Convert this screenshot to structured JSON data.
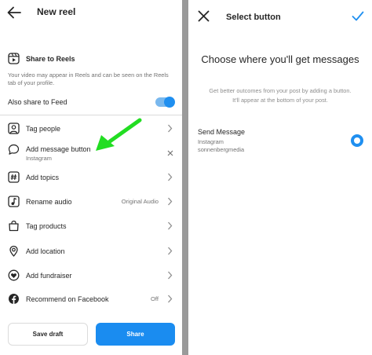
{
  "left": {
    "header": {
      "title": "New reel"
    },
    "share_to_reels": {
      "title": "Share to Reels",
      "description": "Your video may appear in Reels and can be seen on the Reels tab of your profile."
    },
    "also_share": {
      "label": "Also share to Feed",
      "enabled": true
    },
    "rows": [
      {
        "label": "Tag people",
        "icon": "person-icon"
      },
      {
        "label": "Add message button",
        "sublabel": "Instagram",
        "icon": "speech-bubble-icon"
      },
      {
        "label": "Add topics",
        "icon": "hashtag-icon"
      },
      {
        "label": "Rename audio",
        "value": "Original Audio",
        "icon": "music-note-icon"
      },
      {
        "label": "Tag products",
        "icon": "shopping-bag-icon"
      },
      {
        "label": "Add location",
        "icon": "location-pin-icon"
      },
      {
        "label": "Add fundraiser",
        "icon": "fundraiser-icon"
      },
      {
        "label": "Recommend on Facebook",
        "value": "Off",
        "icon": "facebook-icon"
      }
    ],
    "buttons": {
      "save_draft": "Save draft",
      "share": "Share"
    },
    "colors": {
      "accent": "#1a8cf0",
      "arrow": "#22dd22"
    }
  },
  "right": {
    "header": {
      "title": "Select button"
    },
    "heading": "Choose where you'll get messages",
    "description": "Get better outcomes from your post by adding a button. It'll appear at the bottom of your post.",
    "option": {
      "title": "Send Message",
      "sub1": "Instagram",
      "sub2": "sonnenbergmedia",
      "selected": true
    }
  }
}
